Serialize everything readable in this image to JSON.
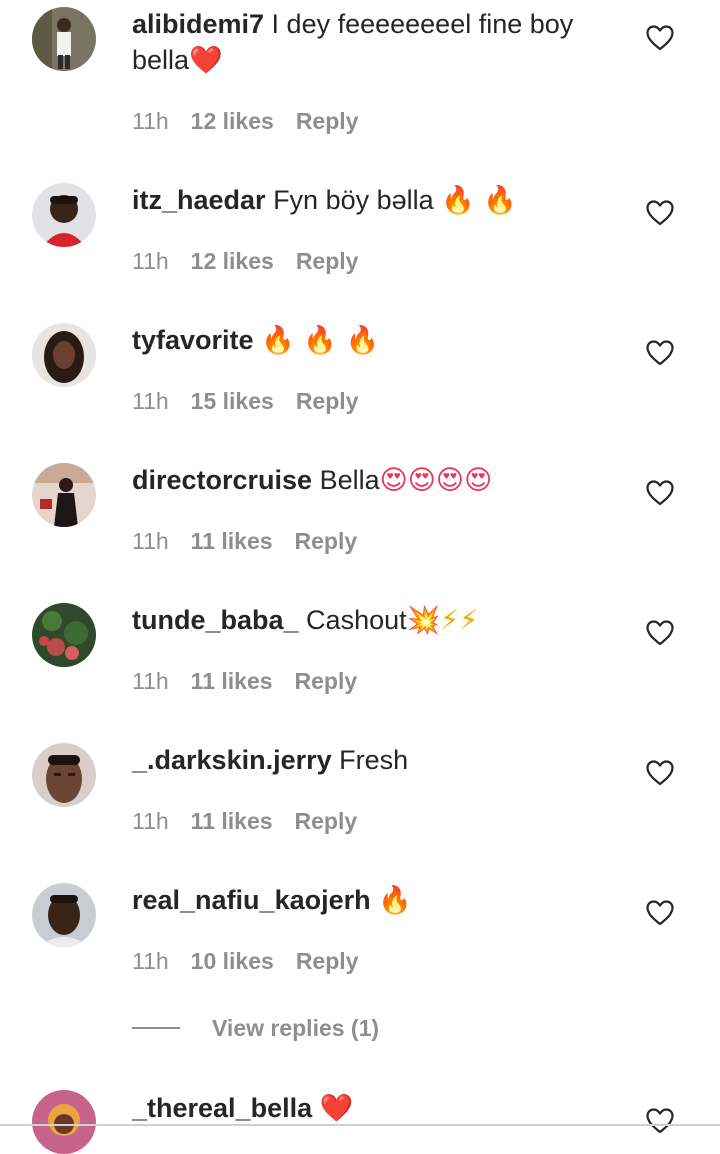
{
  "comments": [
    {
      "username": "alibidemi7",
      "text": " I dey feeeeeeeel fine boy bella",
      "emoji": "❤️",
      "time": "11h",
      "likes": "12 likes",
      "reply": "Reply",
      "avatar_color": "#7a7562"
    },
    {
      "username": "itz_haedar",
      "text": " Fyn böy bəlla ",
      "emoji": "🔥 🔥",
      "time": "11h",
      "likes": "12 likes",
      "reply": "Reply",
      "avatar_color": "#d8d8de"
    },
    {
      "username": "tyfavorite",
      "text": " ",
      "emoji": "🔥 🔥 🔥",
      "time": "11h",
      "likes": "15 likes",
      "reply": "Reply",
      "avatar_color": "#5a3a2c"
    },
    {
      "username": "directorcruise",
      "text": " Bella",
      "emoji": "😍😍😍😍",
      "time": "11h",
      "likes": "11 likes",
      "reply": "Reply",
      "avatar_color": "#d9c7bd"
    },
    {
      "username": "tunde_baba_",
      "text": " Cashout",
      "emoji": "💥⚡⚡",
      "time": "11h",
      "likes": "11 likes",
      "reply": "Reply",
      "avatar_color": "#3d5a33"
    },
    {
      "username": "_.darkskin.jerry",
      "text": " Fresh",
      "emoji": "",
      "time": "11h",
      "likes": "11 likes",
      "reply": "Reply",
      "avatar_color": "#8a6a5a"
    },
    {
      "username": "real_nafiu_kaojerh",
      "text": " ",
      "emoji": "🔥",
      "time": "11h",
      "likes": "10 likes",
      "reply": "Reply",
      "avatar_color": "#c9c9cf"
    },
    {
      "username": "_thereal_bella",
      "text": " ",
      "emoji": "❤️",
      "time": "",
      "likes": "",
      "reply": "",
      "avatar_color": "#c7628a"
    }
  ],
  "view_replies": "View replies (1)",
  "colors": {
    "text": "#262626",
    "meta": "#8e8e8e",
    "fire": "#ff7a00",
    "heart_red": "#e0162b"
  },
  "icons": {
    "like": "heart-outline-icon"
  }
}
